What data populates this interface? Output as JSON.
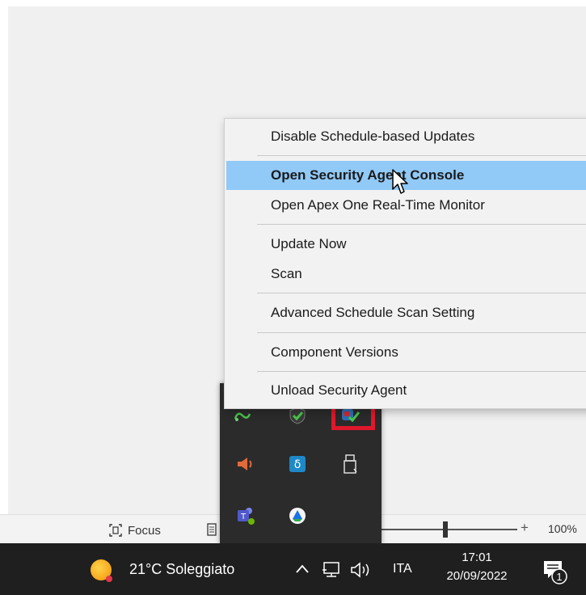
{
  "context_menu": {
    "items": [
      {
        "label": "Disable Schedule-based Updates"
      },
      {
        "label": "Open Security Agent Console",
        "active": true
      },
      {
        "label": "Open Apex One Real-Time Monitor"
      },
      {
        "label": "Update Now"
      },
      {
        "label": "Scan"
      },
      {
        "label": "Advanced Schedule Scan Setting"
      },
      {
        "label": "Component Versions"
      },
      {
        "label": "Unload Security Agent"
      }
    ]
  },
  "statusbar": {
    "focus_label": "Focus",
    "zoom_plus": "+",
    "zoom_level": "100%"
  },
  "taskbar": {
    "weather": "21°C  Soleggiato",
    "language": "ITA",
    "time": "17:01",
    "date": "20/09/2022",
    "notification_count": "1"
  },
  "tray_flyout": {
    "icons": [
      "green-network-icon",
      "shield-check-icon",
      "security-agent-icon",
      "speaker-icon",
      "blue-app-icon",
      "usb-drive-icon",
      "teams-icon",
      "drive-sync-icon"
    ]
  },
  "colors": {
    "menu_highlight": "#91c9f7",
    "highlight_box": "#e0182b",
    "taskbar": "#1f1f1f",
    "flyout": "#2b2b2b"
  }
}
